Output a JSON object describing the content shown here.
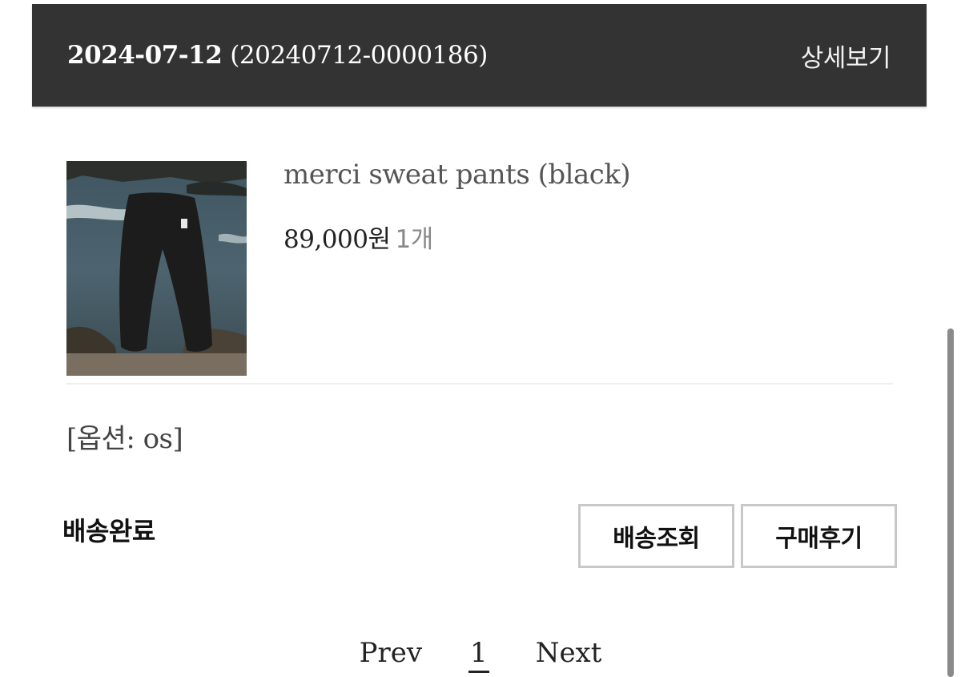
{
  "order": {
    "date": "2024-07-12",
    "number": "(20240712-0000186)",
    "detail_label": "상세보기"
  },
  "product": {
    "name": "merci sweat pants (black)",
    "price": "89,000원",
    "quantity": "1개",
    "option": "[옵션: os]",
    "image_icon": "product-photo-black-pants"
  },
  "status": {
    "label": "배송완료"
  },
  "actions": {
    "track_label": "배송조회",
    "review_label": "구매후기"
  },
  "pagination": {
    "prev_label": "Prev",
    "current_page": "1",
    "next_label": "Next"
  },
  "colors": {
    "header_bg": "#333333",
    "header_text": "#ffffff",
    "button_border": "#c8c8c8",
    "muted_text": "#888888"
  }
}
